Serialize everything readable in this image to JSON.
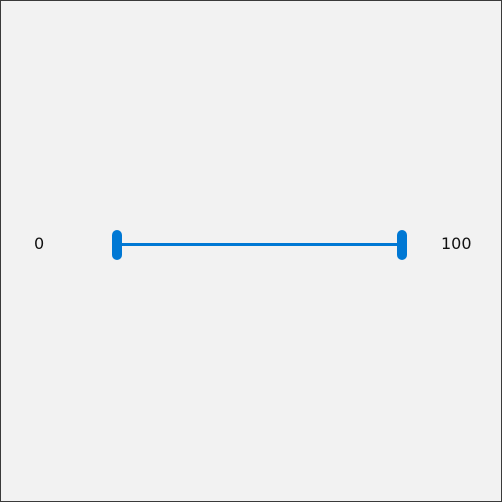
{
  "range_slider": {
    "min_label": "0",
    "max_label": "100",
    "min": 0,
    "max": 100,
    "lower_value": 0,
    "upper_value": 100
  },
  "colors": {
    "background": "#f2f2f2",
    "accent": "#0078d4",
    "text": "#111111"
  }
}
